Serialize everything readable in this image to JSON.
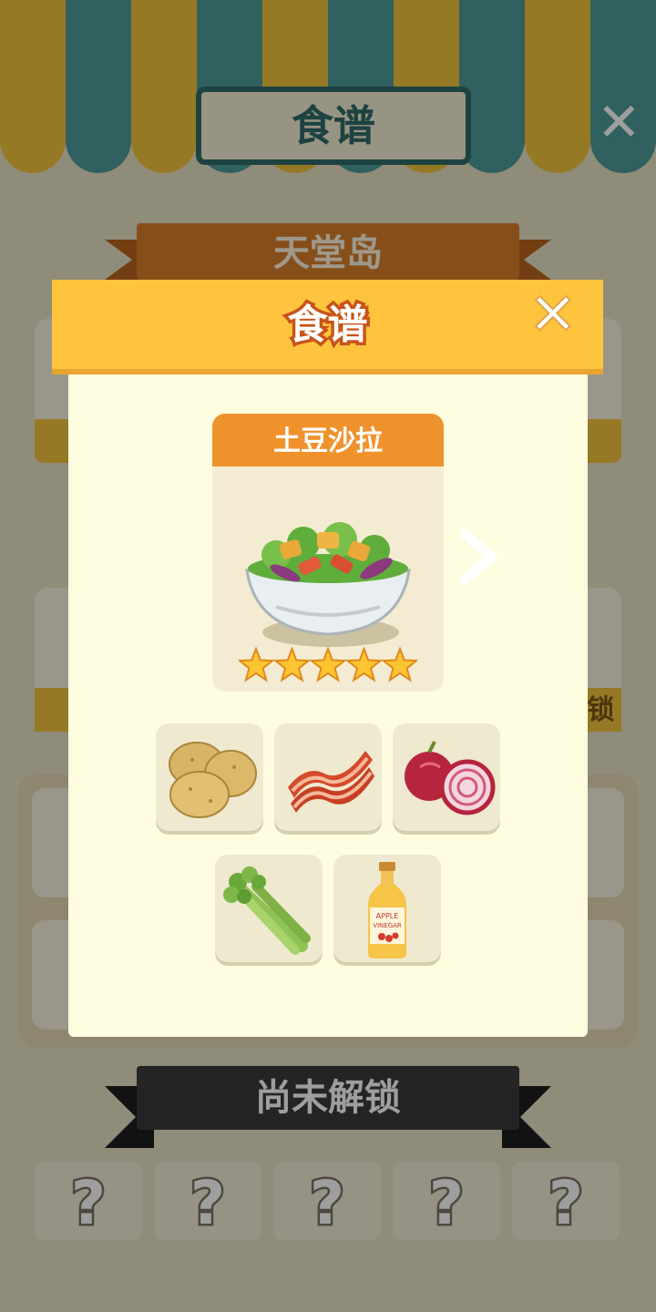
{
  "background": {
    "title": "食谱",
    "close_icon": "close-icon",
    "island_ribbon": "天堂岛",
    "locked_ribbon": "尚未解锁",
    "locked_slots": [
      "?",
      "?",
      "?",
      "?",
      "?"
    ],
    "partial_label": "锁"
  },
  "modal": {
    "title": "食谱",
    "close_icon": "close-icon",
    "recipe": {
      "name": "土豆沙拉",
      "stars": 5,
      "image_icon": "salad-bowl-icon"
    },
    "next_icon": "chevron-right-icon",
    "ingredients": [
      {
        "name": "potato",
        "icon": "potato-icon"
      },
      {
        "name": "bacon",
        "icon": "bacon-icon"
      },
      {
        "name": "red-onion",
        "icon": "red-onion-icon"
      },
      {
        "name": "celery",
        "icon": "celery-icon"
      },
      {
        "name": "apple-vinegar",
        "icon": "vinegar-bottle-icon",
        "label_line1": "APPLE",
        "label_line2": "VINEGAR"
      }
    ]
  },
  "colors": {
    "header_yellow": "#ffc43d",
    "title_stroke": "#c8541b",
    "recipe_orange": "#f0922c",
    "modal_bg": "#fffde0",
    "star": "#ffc531"
  }
}
